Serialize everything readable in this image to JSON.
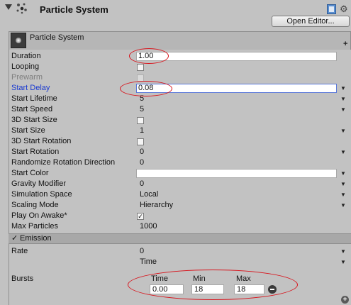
{
  "header": {
    "title": "Particle System",
    "open_editor_label": "Open Editor..."
  },
  "module": {
    "title": "Particle System",
    "plus_label": "+"
  },
  "properties": [
    {
      "label": "Duration",
      "value": "1.00",
      "kind": "field"
    },
    {
      "label": "Looping",
      "value": "",
      "kind": "checkbox",
      "checked": false
    },
    {
      "label": "Prewarm",
      "value": "",
      "kind": "checkbox",
      "checked": false,
      "disabled": true
    },
    {
      "label": "Start Delay",
      "value": "0.08",
      "kind": "field-dropdown"
    },
    {
      "label": "Start Lifetime",
      "value": "5",
      "kind": "field-dropdown"
    },
    {
      "label": "Start Speed",
      "value": "5",
      "kind": "field-dropdown"
    },
    {
      "label": "3D Start Size",
      "value": "",
      "kind": "checkbox",
      "checked": false
    },
    {
      "label": "Start Size",
      "value": "1",
      "kind": "field-dropdown"
    },
    {
      "label": "3D Start Rotation",
      "value": "",
      "kind": "checkbox",
      "checked": false
    },
    {
      "label": "Start Rotation",
      "value": "0",
      "kind": "field-dropdown"
    },
    {
      "label": "Randomize Rotation Direction",
      "value": "0",
      "kind": "field"
    },
    {
      "label": "Start Color",
      "value": "",
      "kind": "color-dropdown"
    },
    {
      "label": "Gravity Modifier",
      "value": "0",
      "kind": "field-dropdown"
    },
    {
      "label": "Simulation Space",
      "value": "Local",
      "kind": "dropdown"
    },
    {
      "label": "Scaling Mode",
      "value": "Hierarchy",
      "kind": "dropdown"
    },
    {
      "label": "Play On Awake*",
      "value": "✓",
      "kind": "checkbox",
      "checked": true
    },
    {
      "label": "Max Particles",
      "value": "1000",
      "kind": "field"
    }
  ],
  "emission": {
    "title": "Emission",
    "check": "✓",
    "rate_label": "Rate",
    "rate_value": "0",
    "rate_unit": "Time",
    "bursts_label": "Bursts",
    "bursts_columns": [
      "Time",
      "Min",
      "Max"
    ],
    "bursts_rows": [
      [
        "0.00",
        "18",
        "18"
      ]
    ]
  },
  "colors": {
    "background": "#c2c2c2",
    "highlight_oval": "#d8141c",
    "start_delay_label": "#1a3ad0",
    "focus_border": "#5a78d8"
  },
  "icons": {
    "help": "help-book-icon",
    "settings": "gear-icon",
    "remove_burst": "minus-circle-icon",
    "add_burst": "plus-circle-icon"
  },
  "arrow_glyph": "▼"
}
